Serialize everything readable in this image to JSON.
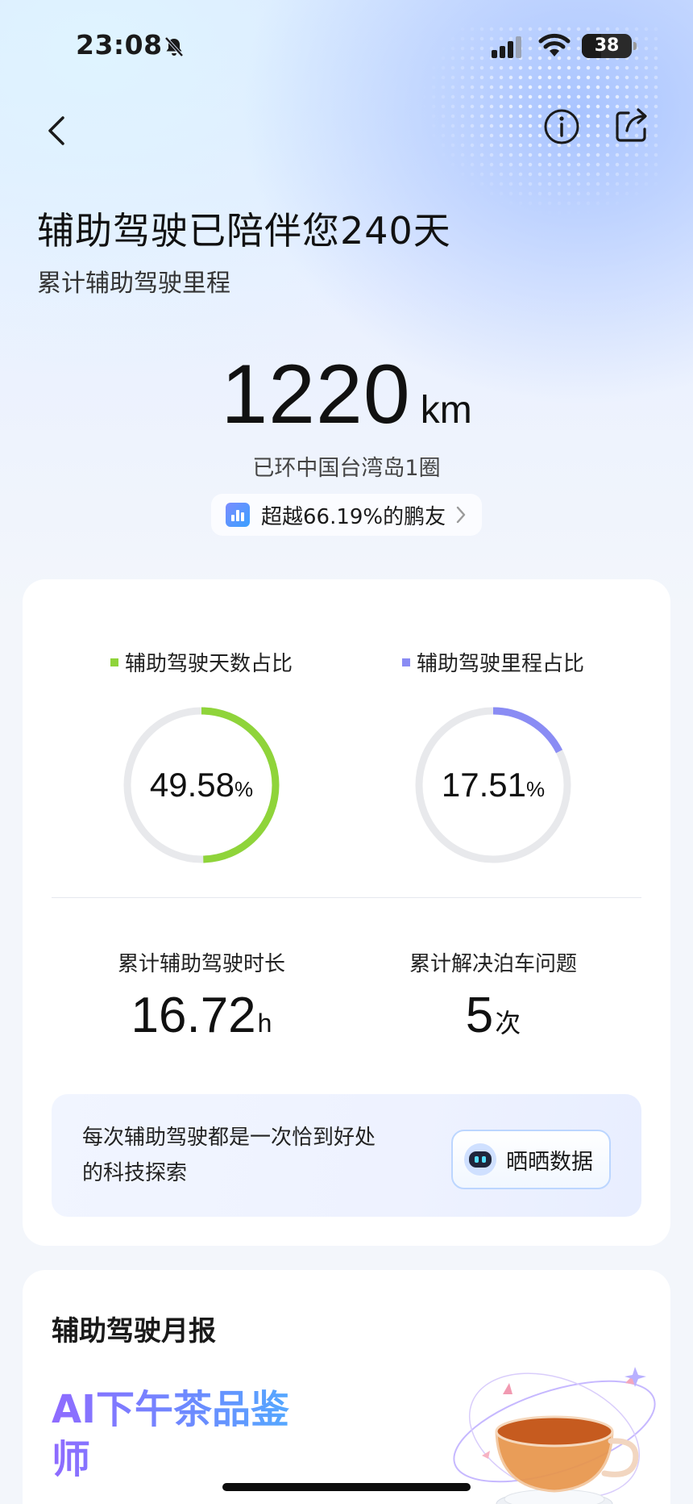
{
  "status_bar": {
    "time": "23:08",
    "battery": "38",
    "battery_level": 0.38
  },
  "nav": {
    "back_icon": "chevron-left-icon",
    "info_icon": "info-icon",
    "share_icon": "share-icon"
  },
  "hero": {
    "headline": "辅助驾驶已陪伴您240天",
    "subhead": "累计辅助驾驶里程",
    "mileage_value": "1220",
    "mileage_unit": "km",
    "loop_text": "已环中国台湾岛1圈",
    "rank_text": "超越66.19%的鹏友"
  },
  "ratios": [
    {
      "title": "辅助驾驶天数占比",
      "value": "49.58",
      "unit": "%",
      "fraction": 0.4958,
      "color": "#8fd43a"
    },
    {
      "title": "辅助驾驶里程占比",
      "value": "17.51",
      "unit": "%",
      "fraction": 0.1751,
      "color": "#8a8cf4"
    }
  ],
  "stats": [
    {
      "label": "累计辅助驾驶时长",
      "value": "16.72",
      "unit": "h"
    },
    {
      "label": "累计解决泊车问题",
      "value": "5",
      "unit": "次"
    }
  ],
  "share": {
    "message": "每次辅助驾驶都是一次恰到好处的科技探索",
    "button_label": "晒晒数据"
  },
  "monthly": {
    "title": "辅助驾驶月报",
    "award": "AI下午茶品鉴师"
  },
  "colors": {
    "ring_track": "#e8e9ec",
    "days_accent": "#8fd43a",
    "mileage_accent": "#8a8cf4"
  }
}
